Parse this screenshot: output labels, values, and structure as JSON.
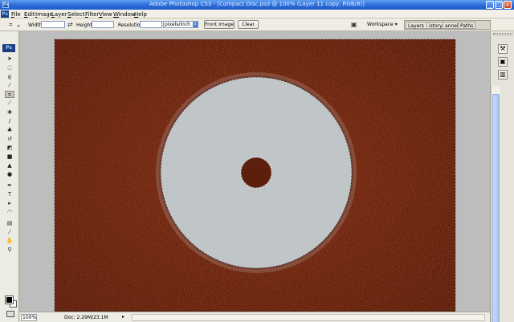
{
  "window": {
    "title": "Adobe Photoshop CS3 - [Compact Disc.psd @ 100% (Layer 11 copy, RGB/8)]",
    "app_icon_label": "Ps",
    "minimize": "_",
    "maximize": "□",
    "close": "×"
  },
  "menu": {
    "logo": "Ps",
    "items": [
      {
        "first": "F",
        "rest": "ile"
      },
      {
        "first": "E",
        "rest": "dit"
      },
      {
        "first": "I",
        "rest": "mage"
      },
      {
        "first": "L",
        "rest": "ayer"
      },
      {
        "first": "S",
        "rest": "elect"
      },
      {
        "first": "F",
        "rest": "ilter"
      },
      {
        "first": "V",
        "rest": "iew"
      },
      {
        "first": "W",
        "rest": "indow"
      },
      {
        "first": "H",
        "rest": "elp"
      }
    ]
  },
  "options": {
    "width_label": "Width:",
    "width_value": "",
    "height_label": "Height:",
    "height_value": "",
    "resolution_label": "Resolution:",
    "resolution_value": "",
    "resolution_unit": "pixels/inch",
    "front_image": "Front Image",
    "clear": "Clear",
    "workspace": "Workspace ▾"
  },
  "palette_well": {
    "tabs": [
      "Layers ×",
      "istory",
      "annels",
      "Paths"
    ]
  },
  "toolbox": {
    "header": "Ps",
    "tools": [
      {
        "name": "move-tool",
        "glyph": "➤"
      },
      {
        "name": "marquee-tool",
        "glyph": "◌"
      },
      {
        "name": "lasso-tool",
        "glyph": "ϱ"
      },
      {
        "name": "magic-wand-tool",
        "glyph": "⁄"
      },
      {
        "name": "crop-tool",
        "glyph": "⌗"
      },
      {
        "name": "slice-tool",
        "glyph": "⟋"
      },
      {
        "name": "healing-brush-tool",
        "glyph": "✚"
      },
      {
        "name": "brush-tool",
        "glyph": "∕"
      },
      {
        "name": "clone-stamp-tool",
        "glyph": "♣"
      },
      {
        "name": "history-brush-tool",
        "glyph": "↺"
      },
      {
        "name": "eraser-tool",
        "glyph": "◩"
      },
      {
        "name": "gradient-tool",
        "glyph": "■"
      },
      {
        "name": "blur-tool",
        "glyph": "▲"
      },
      {
        "name": "dodge-tool",
        "glyph": "●"
      },
      {
        "name": "pen-tool",
        "glyph": "✒"
      },
      {
        "name": "type-tool",
        "glyph": "T"
      },
      {
        "name": "path-selection-tool",
        "glyph": "▸"
      },
      {
        "name": "shape-tool",
        "glyph": "◠"
      },
      {
        "name": "notes-tool",
        "glyph": "▤"
      },
      {
        "name": "eyedropper-tool",
        "glyph": "⁄"
      },
      {
        "name": "hand-tool",
        "glyph": "✋"
      },
      {
        "name": "zoom-tool",
        "glyph": "⚲"
      }
    ]
  },
  "status": {
    "zoom": "100%",
    "doc": "Doc: 2.29M/23.1M",
    "arrow": "▸"
  },
  "colors": {
    "canvas_bg": "#bdbdbd",
    "leather": "#6b2410",
    "disc": "#c0c5c8",
    "ring": "#8e5a4b",
    "hole": "#5c1f0d"
  }
}
